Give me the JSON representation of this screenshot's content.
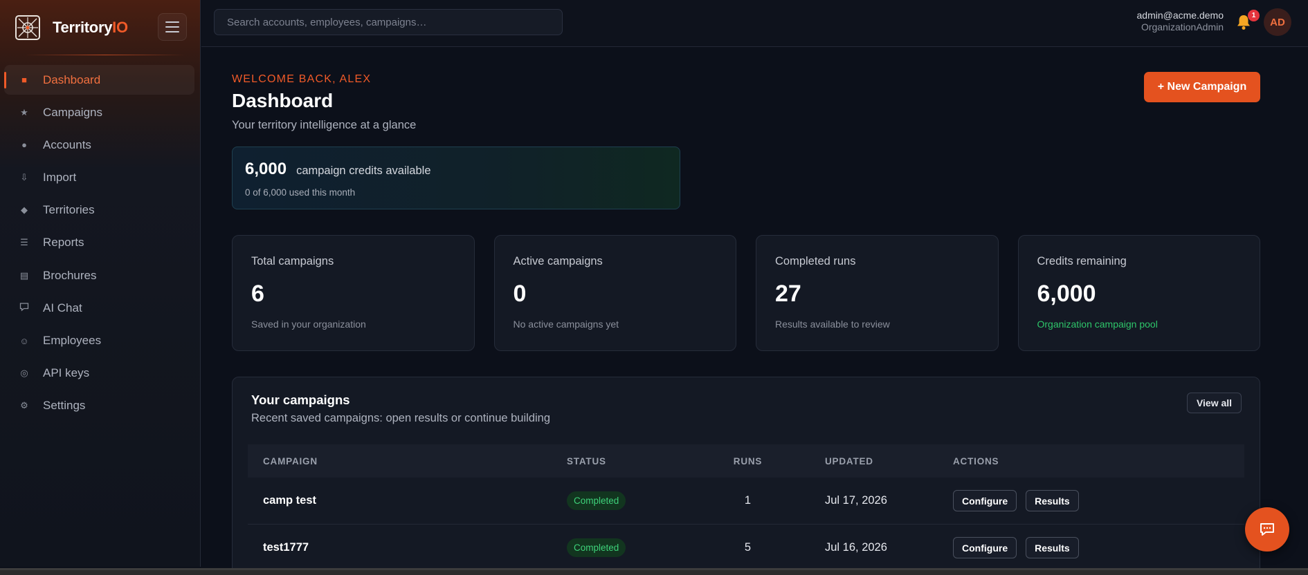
{
  "brand": {
    "name_main": "Territory",
    "name_accent": "IO"
  },
  "sidebar": {
    "items": [
      {
        "label": "Dashboard",
        "icon": "■",
        "active": true
      },
      {
        "label": "Campaigns",
        "icon": "★"
      },
      {
        "label": "Accounts",
        "icon": "●"
      },
      {
        "label": "Import",
        "icon": "⇩"
      },
      {
        "label": "Territories",
        "icon": "◆"
      },
      {
        "label": "Reports",
        "icon": "☰"
      },
      {
        "label": "Brochures",
        "icon": "▤"
      },
      {
        "label": "AI Chat",
        "icon": "▭"
      },
      {
        "label": "Employees",
        "icon": "☺"
      },
      {
        "label": "API keys",
        "icon": "◎"
      },
      {
        "label": "Settings",
        "icon": "⚙"
      }
    ]
  },
  "topbar": {
    "search_placeholder": "Search accounts, employees, campaigns…",
    "user_email": "admin@acme.demo",
    "user_role": "OrganizationAdmin",
    "notifications": "1",
    "avatar_initials": "AD"
  },
  "header": {
    "welcome": "WELCOME BACK, ALEX",
    "title": "Dashboard",
    "subtitle": "Your territory intelligence at a glance",
    "new_campaign_label": "+ New Campaign"
  },
  "credits": {
    "amount": "6,000",
    "label": "campaign credits available",
    "usage": "0 of 6,000 used this month"
  },
  "stats": [
    {
      "label": "Total campaigns",
      "value": "6",
      "sub": "Saved in your organization"
    },
    {
      "label": "Active campaigns",
      "value": "0",
      "sub": "No active campaigns yet"
    },
    {
      "label": "Completed runs",
      "value": "27",
      "sub": "Results available to review"
    },
    {
      "label": "Credits remaining",
      "value": "6,000",
      "sub": "Organization campaign pool"
    }
  ],
  "campaigns": {
    "title": "Your campaigns",
    "subtitle": "Recent saved campaigns: open results or continue building",
    "view_all_label": "View all",
    "columns": [
      "CAMPAIGN",
      "STATUS",
      "RUNS",
      "UPDATED",
      "ACTIONS"
    ],
    "rows": [
      {
        "name": "camp test",
        "status": "Completed",
        "runs": "1",
        "updated": "Jul 17, 2026",
        "configure": "Configure",
        "results": "Results"
      },
      {
        "name": "test1777",
        "status": "Completed",
        "runs": "5",
        "updated": "Jul 16, 2026",
        "configure": "Configure",
        "results": "Results"
      }
    ]
  },
  "colors": {
    "accent": "#e4521f",
    "success": "#3ed27a",
    "background": "#0c101a"
  }
}
